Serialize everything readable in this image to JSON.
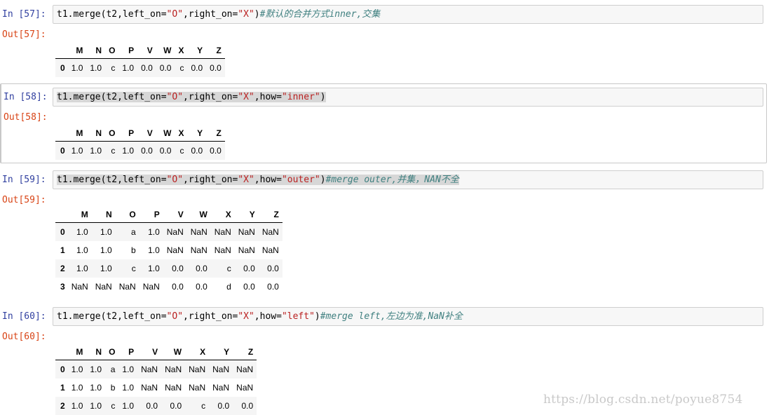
{
  "cells": [
    {
      "in_prompt": "In [57]:",
      "out_prompt": "Out[57]:",
      "code": [
        {
          "t": "t1.merge(t2,left_on=",
          "c": "plain"
        },
        {
          "t": "\"O\"",
          "c": "str"
        },
        {
          "t": ",right_on=",
          "c": "plain"
        },
        {
          "t": "\"X\"",
          "c": "str"
        },
        {
          "t": ")",
          "c": "plain"
        },
        {
          "t": "#默认的合并方式inner,交集",
          "c": "cm"
        }
      ],
      "table": {
        "columns": [
          "M",
          "N",
          "O",
          "P",
          "V",
          "W",
          "X",
          "Y",
          "Z"
        ],
        "rows": [
          {
            "index": "0",
            "values": [
              "1.0",
              "1.0",
              "c",
              "1.0",
              "0.0",
              "0.0",
              "c",
              "0.0",
              "0.0"
            ]
          }
        ]
      }
    },
    {
      "in_prompt": "In [58]:",
      "out_prompt": "Out[58]:",
      "code": [
        {
          "t": "t1.merge(t2,left_on=",
          "c": "plain"
        },
        {
          "t": "\"O\"",
          "c": "str"
        },
        {
          "t": ",right_on=",
          "c": "plain"
        },
        {
          "t": "\"X\"",
          "c": "str"
        },
        {
          "t": ",how=",
          "c": "plain"
        },
        {
          "t": "\"inner\"",
          "c": "str"
        },
        {
          "t": ")",
          "c": "plain"
        }
      ],
      "table": {
        "columns": [
          "M",
          "N",
          "O",
          "P",
          "V",
          "W",
          "X",
          "Y",
          "Z"
        ],
        "rows": [
          {
            "index": "0",
            "values": [
              "1.0",
              "1.0",
              "c",
              "1.0",
              "0.0",
              "0.0",
              "c",
              "0.0",
              "0.0"
            ]
          }
        ]
      }
    },
    {
      "in_prompt": "In [59]:",
      "out_prompt": "Out[59]:",
      "code": [
        {
          "t": "t1.merge(t2,left_on=",
          "c": "plain"
        },
        {
          "t": "\"O\"",
          "c": "str"
        },
        {
          "t": ",right_on=",
          "c": "plain"
        },
        {
          "t": "\"X\"",
          "c": "str"
        },
        {
          "t": ",how=",
          "c": "plain"
        },
        {
          "t": "\"outer\"",
          "c": "str"
        },
        {
          "t": ")",
          "c": "plain"
        },
        {
          "t": "#merge outer,并集，NAN不全",
          "c": "cm"
        }
      ],
      "table": {
        "columns": [
          "M",
          "N",
          "O",
          "P",
          "V",
          "W",
          "X",
          "Y",
          "Z"
        ],
        "rows": [
          {
            "index": "0",
            "values": [
              "1.0",
              "1.0",
              "a",
              "1.0",
              "NaN",
              "NaN",
              "NaN",
              "NaN",
              "NaN"
            ]
          },
          {
            "index": "1",
            "values": [
              "1.0",
              "1.0",
              "b",
              "1.0",
              "NaN",
              "NaN",
              "NaN",
              "NaN",
              "NaN"
            ]
          },
          {
            "index": "2",
            "values": [
              "1.0",
              "1.0",
              "c",
              "1.0",
              "0.0",
              "0.0",
              "c",
              "0.0",
              "0.0"
            ]
          },
          {
            "index": "3",
            "values": [
              "NaN",
              "NaN",
              "NaN",
              "NaN",
              "0.0",
              "0.0",
              "d",
              "0.0",
              "0.0"
            ]
          }
        ]
      }
    },
    {
      "in_prompt": "In [60]:",
      "out_prompt": "Out[60]:",
      "code": [
        {
          "t": "t1.merge(t2,left_on=",
          "c": "plain"
        },
        {
          "t": "\"O\"",
          "c": "str"
        },
        {
          "t": ",right_on=",
          "c": "plain"
        },
        {
          "t": "\"X\"",
          "c": "str"
        },
        {
          "t": ",how=",
          "c": "plain"
        },
        {
          "t": "\"left\"",
          "c": "str"
        },
        {
          "t": ")",
          "c": "plain"
        },
        {
          "t": "#merge left,左边为准,NaN补全",
          "c": "cm"
        }
      ],
      "table": {
        "columns": [
          "M",
          "N",
          "O",
          "P",
          "V",
          "W",
          "X",
          "Y",
          "Z"
        ],
        "rows": [
          {
            "index": "0",
            "values": [
              "1.0",
              "1.0",
              "a",
              "1.0",
              "NaN",
              "NaN",
              "NaN",
              "NaN",
              "NaN"
            ]
          },
          {
            "index": "1",
            "values": [
              "1.0",
              "1.0",
              "b",
              "1.0",
              "NaN",
              "NaN",
              "NaN",
              "NaN",
              "NaN"
            ]
          },
          {
            "index": "2",
            "values": [
              "1.0",
              "1.0",
              "c",
              "1.0",
              "0.0",
              "0.0",
              "c",
              "0.0",
              "0.0"
            ]
          }
        ]
      }
    }
  ],
  "watermark": "https://blog.csdn.net/poyue8754"
}
